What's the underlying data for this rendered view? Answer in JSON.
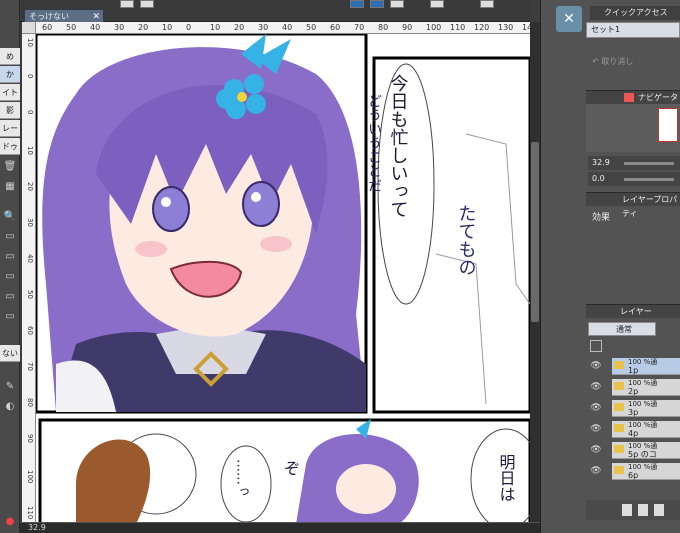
{
  "document": {
    "tab_title": "そっけない",
    "close_glyph": "✕"
  },
  "left_strip": {
    "tabs": [
      "め",
      "か",
      "イト",
      "影",
      "レー",
      "ドゥ"
    ],
    "side_labels": [
      "ない"
    ]
  },
  "ruler_h_ticks": [
    "60",
    "50",
    "40",
    "30",
    "20",
    "10",
    "0",
    "10",
    "20",
    "30",
    "40",
    "50",
    "60",
    "70",
    "80",
    "90",
    "100",
    "110",
    "120",
    "130",
    "140"
  ],
  "ruler_v_ticks": [
    "10",
    "0",
    "0",
    "10",
    "20",
    "30",
    "40",
    "50",
    "60",
    "70",
    "80",
    "90",
    "100",
    "110"
  ],
  "status": {
    "zoom": "32.9"
  },
  "quick_access": {
    "title": "クイックアクセス",
    "set_value": "セット1",
    "undo_label": "取り消し"
  },
  "navigator": {
    "title": "ナビゲーター",
    "zoom": "32.9",
    "rotation": "0.0"
  },
  "layer_property": {
    "title": "レイヤープロパティ",
    "effect_label": "効果"
  },
  "layers_panel": {
    "title": "レイヤー",
    "blend_mode": "通常",
    "items": [
      {
        "opacity": "100 %通",
        "name": "1p"
      },
      {
        "opacity": "100 %通",
        "name": "2p"
      },
      {
        "opacity": "100 %通",
        "name": "3p"
      },
      {
        "opacity": "100 %通",
        "name": "4p"
      },
      {
        "opacity": "100 %通",
        "name": "5p のコ"
      },
      {
        "opacity": "100 %通",
        "name": "6p"
      }
    ]
  },
  "artwork": {
    "bubble_top": "今日も忙しいって",
    "bubble_top_b": "どういうことだ",
    "side_text": "たてもの",
    "bubble_bottom": "明日は",
    "bubble_bottom_small": "……っ",
    "sfx": "ぞ"
  },
  "colors": {
    "hair": "#8a6cc9",
    "hair_dark": "#5b3e9a",
    "flower": "#35b3e6",
    "panel_bg": "#535353",
    "selection": "#b7cbe6"
  }
}
